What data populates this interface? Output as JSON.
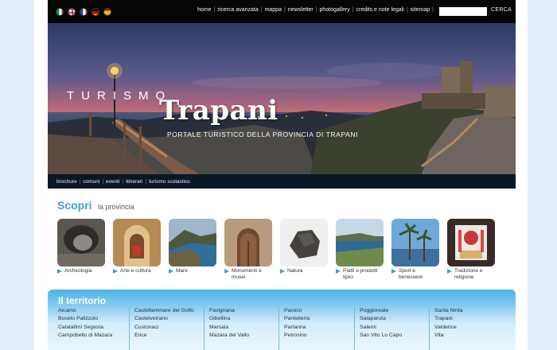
{
  "header": {
    "flags": [
      {
        "name": "italian-flag-icon",
        "colors": [
          "#009246",
          "#ffffff",
          "#ce2b37"
        ]
      },
      {
        "name": "uk-flag-icon",
        "colors": [
          "#012169",
          "#ffffff",
          "#c8102e"
        ]
      },
      {
        "name": "french-flag-icon",
        "colors": [
          "#0055a4",
          "#ffffff",
          "#ef4135"
        ]
      },
      {
        "name": "german-flag-icon",
        "colors": [
          "#000000",
          "#dd0000",
          "#ffce00"
        ]
      },
      {
        "name": "spanish-flag-icon",
        "colors": [
          "#aa151b",
          "#f1bf00",
          "#aa151b"
        ]
      }
    ],
    "nav": [
      "home",
      "ricerca avanzata",
      "mappa",
      "newsletter",
      "photogallery",
      "credits e note legali",
      "sitemap"
    ],
    "search": {
      "placeholder": "",
      "button_label": "CERCA"
    }
  },
  "hero": {
    "word1": "TURISMO",
    "word2": "Trapani",
    "subtitle": "PORTALE TURISTICO DELLA PROVINCIA DI TRAPANI"
  },
  "subnav": [
    "brochure",
    "comuni",
    "eventi",
    "itinerari",
    "turismo scolastico"
  ],
  "scopri": {
    "title": "Scopri",
    "subtitle": "la provincia",
    "items": [
      {
        "label": "Archeologia"
      },
      {
        "label": "Arte e cultura"
      },
      {
        "label": "Mare"
      },
      {
        "label": "Monumenti e musei"
      },
      {
        "label": "Natura"
      },
      {
        "label": "Piatti e prodotti tipici"
      },
      {
        "label": "Sport e benessere"
      },
      {
        "label": "Tradizione e religione"
      }
    ]
  },
  "territorio": {
    "title": "Il territorio",
    "columns": [
      [
        "Alcamo",
        "Buseto Palizzolo",
        "Calatafimi Segesta",
        "Campobello di Mazara"
      ],
      [
        "Castellammare del Golfo",
        "Castelvetrano",
        "Custonaci",
        "Erice"
      ],
      [
        "Favignana",
        "Gibellina",
        "Marsala",
        "Mazara del Vallo"
      ],
      [
        "Paceco",
        "Pantelleria",
        "Partanna",
        "Petrosino"
      ],
      [
        "Poggioreale",
        "Salaparuta",
        "Salemi",
        "San Vito Lo Capo"
      ],
      [
        "Santa Ninfa",
        "Trapani",
        "Valderice",
        "Vita"
      ]
    ]
  },
  "colors": {
    "accent": "#3aa0dd",
    "topbar": "#060606",
    "subnav": "#071725"
  }
}
